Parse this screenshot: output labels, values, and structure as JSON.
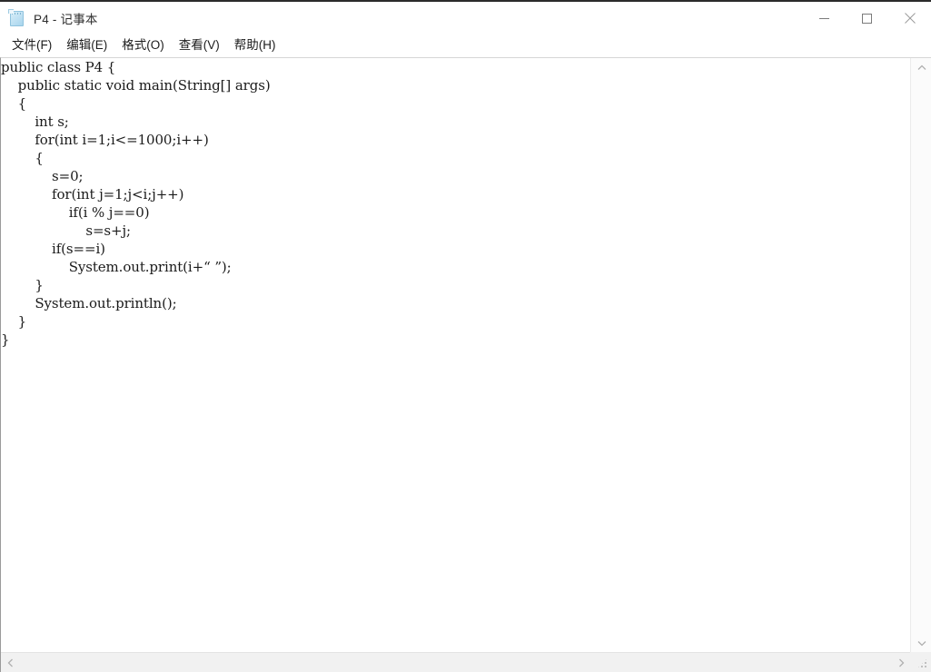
{
  "window": {
    "title": "P4 - 记事本",
    "app_icon": "notepad-icon"
  },
  "titlebar_buttons": [
    {
      "name": "minimize",
      "glyph": "—"
    },
    {
      "name": "maximize",
      "glyph": "□"
    },
    {
      "name": "close",
      "glyph": "✕"
    }
  ],
  "menubar": {
    "items": [
      {
        "label": "文件(F)"
      },
      {
        "label": "编辑(E)"
      },
      {
        "label": "格式(O)"
      },
      {
        "label": "查看(V)"
      },
      {
        "label": "帮助(H)"
      }
    ]
  },
  "editor": {
    "content": "public class P4 {\n    public static void main(String[] args)\n    {\n        int s;\n        for(int i=1;i<=1000;i++)\n        {\n            s=0;\n            for(int j=1;j<i;j++)\n                if(i % j==0)\n                    s=s+j;\n            if(s==i)\n                System.out.print(i+“ ”);\n        }\n        System.out.println();\n    }\n}",
    "lines": [
      "public class P4 {",
      "    public static void main(String[] args)",
      "    {",
      "        int s;",
      "        for(int i=1;i<=1000;i++)",
      "        {",
      "            s=0;",
      "            for(int j=1;j<i;j++)",
      "                if(i % j==0)",
      "                    s=s+j;",
      "            if(s==i)",
      "                System.out.print(i+“ ”);",
      "        }",
      "        System.out.println();",
      "    }",
      "}"
    ]
  },
  "scrollbars": {
    "vertical": {
      "up_icon": "chevron-up-icon",
      "down_icon": "chevron-down-icon",
      "thumb_visible": false
    },
    "horizontal": {
      "left_icon": "chevron-left-icon",
      "right_icon": "chevron-right-icon",
      "thumb_visible": false
    },
    "resize_grip": "resize-grip-icon"
  },
  "colors": {
    "window_bg": "#ffffff",
    "text": "#1a1a1a",
    "titlebar_border": "#2b2b2b",
    "scrollbar_track": "#f1f1f1",
    "close_hover": "#e81123"
  }
}
